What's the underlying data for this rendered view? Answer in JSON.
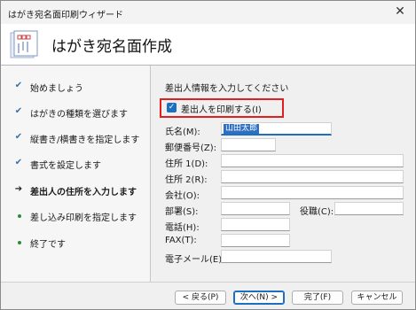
{
  "window": {
    "title": "はがき宛名面印刷ウィザード",
    "close_glyph": "✕"
  },
  "header": {
    "title": "はがき宛名面作成",
    "icon": "postcard-icon"
  },
  "sidebar": {
    "steps": [
      {
        "label": "始めましょう",
        "state": "done"
      },
      {
        "label": "はがきの種類を選びます",
        "state": "done"
      },
      {
        "label": "縦書き/横書きを指定します",
        "state": "done"
      },
      {
        "label": "書式を設定します",
        "state": "done"
      },
      {
        "label": "差出人の住所を入力します",
        "state": "current"
      },
      {
        "label": "差し込み印刷を指定します",
        "state": "pending"
      },
      {
        "label": "終了です",
        "state": "pending"
      }
    ],
    "check_glyph": "✔",
    "arrow_glyph": "➔"
  },
  "main": {
    "heading": "差出人情報を入力してください",
    "print_sender": {
      "label": "差出人を印刷する(I)",
      "checked": true,
      "check_glyph": "✓"
    },
    "fields": {
      "name": {
        "label": "氏名(M):",
        "value": "山田太郎"
      },
      "postal": {
        "label": "郵便番号(Z):",
        "value": ""
      },
      "address1": {
        "label": "住所 1(D):",
        "value": ""
      },
      "address2": {
        "label": "住所 2(R):",
        "value": ""
      },
      "company": {
        "label": "会社(O):",
        "value": ""
      },
      "department": {
        "label": "部署(S):",
        "value": ""
      },
      "title": {
        "label": "役職(C):",
        "value": ""
      },
      "phone": {
        "label": "電話(H):",
        "value": ""
      },
      "fax": {
        "label": "FAX(T):",
        "value": ""
      },
      "email": {
        "label": "電子メール(E)",
        "value": ""
      }
    }
  },
  "footer": {
    "back": "< 戻る(P)",
    "next": "次へ(N) >",
    "finish": "完了(F)",
    "cancel": "キャンセル"
  },
  "colors": {
    "accent": "#1f6fbf",
    "highlight_box": "#e02020",
    "step_check": "#3a6fa8",
    "step_dot": "#2d8a3e"
  }
}
